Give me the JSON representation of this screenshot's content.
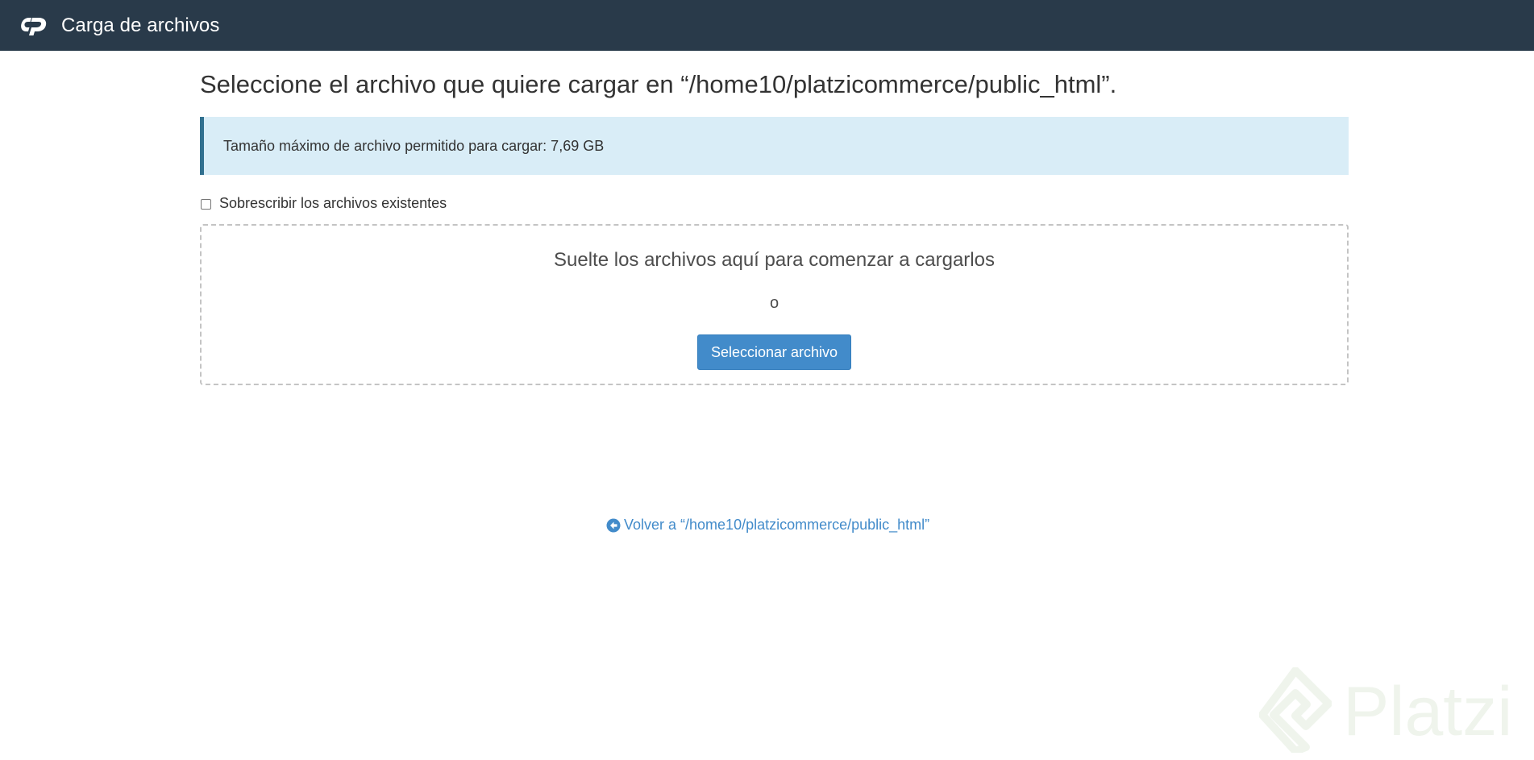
{
  "header": {
    "logo_icon": "cpanel-logo-icon",
    "title": "Carga de archivos"
  },
  "main": {
    "title": "Seleccione el archivo que quiere cargar en “/home10/platzicommerce/public_html”.",
    "info": "Tamaño máximo de archivo permitido para cargar: 7,69 GB",
    "overwrite": {
      "label": "Sobrescribir los archivos existentes",
      "checked": false
    },
    "dropzone": {
      "text": "Suelte los archivos aquí para comenzar a cargarlos",
      "or": "o",
      "button_label": "Seleccionar archivo"
    },
    "back": {
      "icon": "arrow-circle-left-icon",
      "label": "Volver a “/home10/platzicommerce/public_html”"
    }
  },
  "watermark": {
    "text": "Platzi"
  },
  "colors": {
    "header_bg": "#293a4a",
    "info_bg": "#d9edf7",
    "info_border": "#31708f",
    "primary": "#428bca"
  }
}
